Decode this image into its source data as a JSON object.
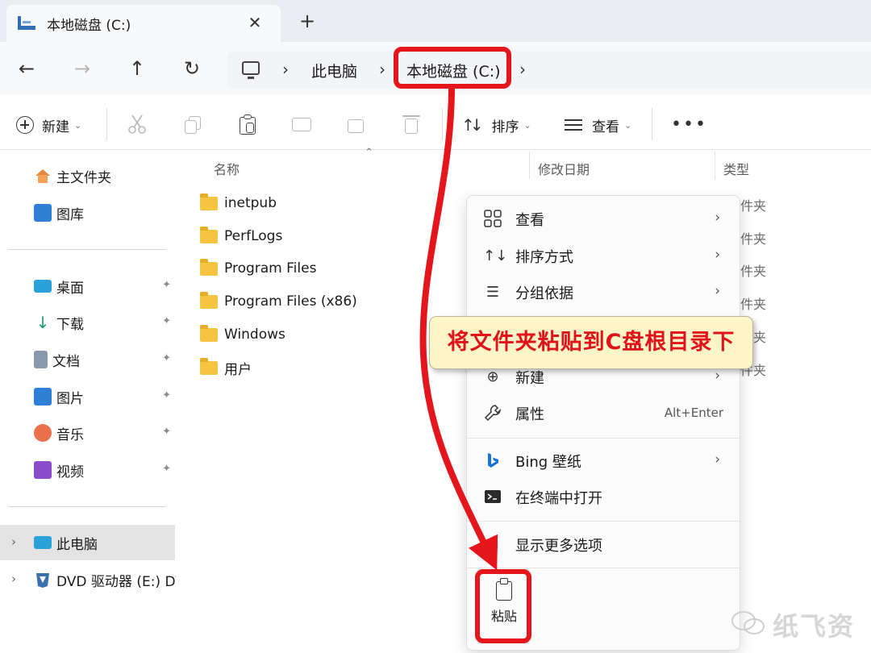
{
  "tab": {
    "title": "本地磁盘 (C:)",
    "close_glyph": "✕",
    "new_tab_glyph": "+"
  },
  "nav": {
    "back_glyph": "←",
    "forward_glyph": "→",
    "up_glyph": "↑",
    "refresh_glyph": "↻"
  },
  "address": {
    "crumbs": [
      "此电脑",
      "本地磁盘 (C:)"
    ],
    "separator": "›"
  },
  "commandbar": {
    "new_label": "新建",
    "sort_label": "排序",
    "view_label": "查看",
    "more_glyph": "•••",
    "caret": "⌄"
  },
  "sidebar": {
    "quick": [
      {
        "label": "主文件夹",
        "icon": "home-icon"
      },
      {
        "label": "图库",
        "icon": "gallery-icon"
      }
    ],
    "pinned": [
      {
        "label": "桌面",
        "icon": "desktop-icon"
      },
      {
        "label": "下载",
        "icon": "download-icon"
      },
      {
        "label": "文档",
        "icon": "document-icon"
      },
      {
        "label": "图片",
        "icon": "pictures-icon"
      },
      {
        "label": "音乐",
        "icon": "music-icon"
      },
      {
        "label": "视频",
        "icon": "video-icon"
      }
    ],
    "drives": [
      {
        "label": "此电脑",
        "icon": "this-pc-icon",
        "selected": true
      },
      {
        "label": "DVD 驱动器 (E:) DV",
        "icon": "dvd-drive-icon"
      }
    ],
    "pin_glyph": "📌",
    "expand_glyph": "›"
  },
  "columns": {
    "name": "名称",
    "modified": "修改日期",
    "type": "类型"
  },
  "files": [
    {
      "name": "inetpub",
      "type": "件夹"
    },
    {
      "name": "PerfLogs",
      "type": "件夹"
    },
    {
      "name": "Program Files",
      "type": "件夹"
    },
    {
      "name": "Program Files (x86)",
      "type": "件夹"
    },
    {
      "name": "Windows",
      "type": "夹"
    },
    {
      "name": "用户",
      "type": "件夹"
    }
  ],
  "context_menu": {
    "items": [
      {
        "label": "查看",
        "icon": "grid-view-icon",
        "submenu": true
      },
      {
        "label": "排序方式",
        "icon": "sort-icon",
        "submenu": true
      },
      {
        "label": "分组依据",
        "icon": "group-by-icon",
        "submenu": true
      },
      {
        "label": "新建",
        "icon": "new-icon",
        "submenu": true
      },
      {
        "label": "属性",
        "icon": "wrench-icon",
        "shortcut": "Alt+Enter"
      },
      {
        "label": "Bing 壁纸",
        "icon": "bing-icon",
        "submenu": true
      },
      {
        "label": "在终端中打开",
        "icon": "terminal-icon"
      },
      {
        "label": "显示更多选项",
        "icon": "more-options-icon"
      }
    ],
    "paste_label": "粘贴",
    "chevron": "›"
  },
  "annotation": {
    "callout_text": "将文件夹粘贴到C盘根目录下",
    "color": "#e4151b"
  },
  "watermark": {
    "text": "纸飞资"
  }
}
